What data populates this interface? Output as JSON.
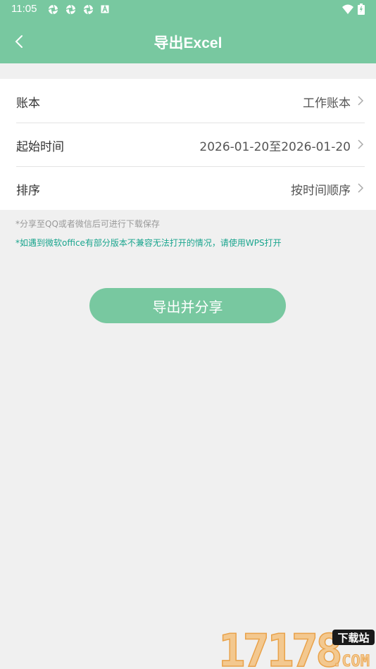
{
  "status_bar": {
    "time": "11:05",
    "notification_icons": [
      "aperture-icon",
      "aperture-icon",
      "aperture-icon",
      "a-box-icon"
    ],
    "right_icons": [
      "wifi-icon",
      "battery-icon"
    ]
  },
  "header": {
    "title": "导出Excel",
    "back_icon": "chevron-left-icon",
    "background_color": "#78c8a0"
  },
  "settings": [
    {
      "label": "账本",
      "value": "工作账本"
    },
    {
      "label": "起始时间",
      "value": "2026-01-20至2026-01-20"
    },
    {
      "label": "排序",
      "value": "按时间顺序"
    }
  ],
  "notes": {
    "share_hint": "*分享至QQ或者微信后可进行下载保存",
    "compat_hint": "*如遇到微软office有部分版本不兼容无法打开的情况，请使用WPS打开"
  },
  "actions": {
    "export_share_label": "导出并分享"
  },
  "watermark": {
    "text": "17178",
    "badge": "下载站",
    "suffix": ".COM"
  },
  "colors": {
    "accent": "#78c8a0",
    "note_teal": "#1aa58e",
    "page_bg": "#f0f0f0"
  }
}
